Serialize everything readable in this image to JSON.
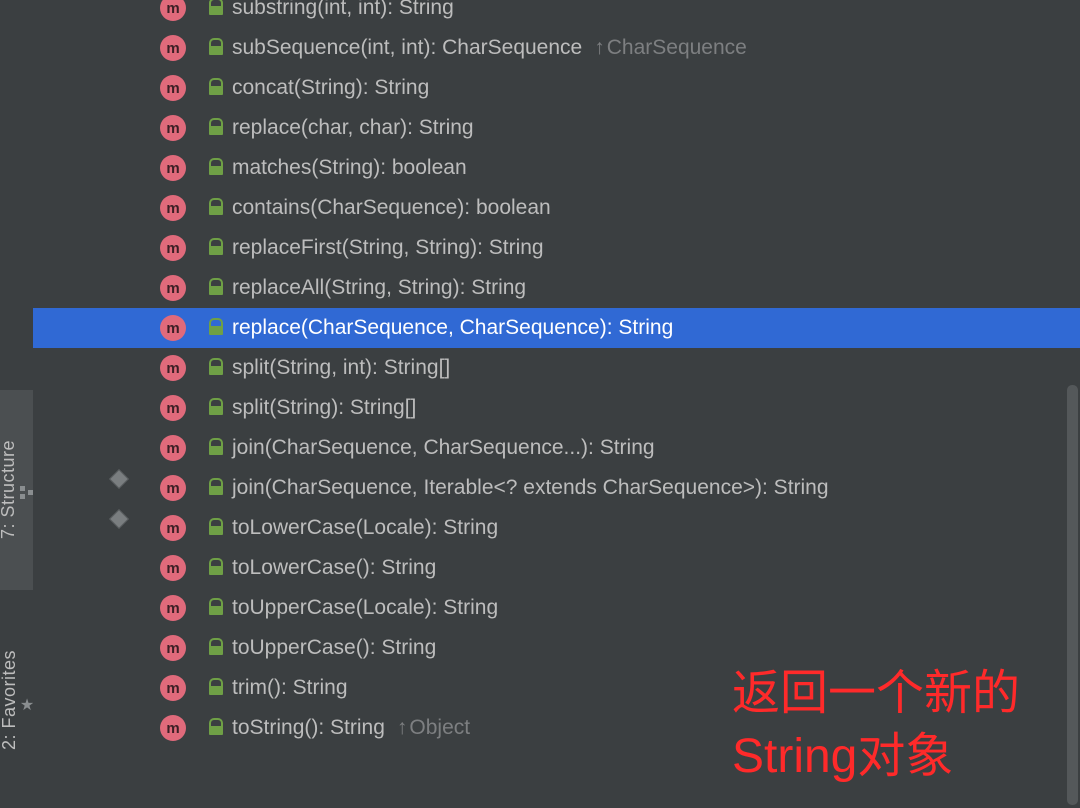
{
  "toolwindows": [
    {
      "id": "structure",
      "label": "7: Structure",
      "selected": true,
      "icon": "structure"
    },
    {
      "id": "favorites",
      "label": "2: Favorites",
      "selected": false,
      "icon": "star"
    }
  ],
  "methods": [
    {
      "sig": "substring(int, int): String",
      "static": false,
      "inherit": ""
    },
    {
      "sig": "subSequence(int, int): CharSequence",
      "static": false,
      "inherit": "CharSequence"
    },
    {
      "sig": "concat(String): String",
      "static": false,
      "inherit": ""
    },
    {
      "sig": "replace(char, char): String",
      "static": false,
      "inherit": ""
    },
    {
      "sig": "matches(String): boolean",
      "static": false,
      "inherit": ""
    },
    {
      "sig": "contains(CharSequence): boolean",
      "static": false,
      "inherit": ""
    },
    {
      "sig": "replaceFirst(String, String): String",
      "static": false,
      "inherit": ""
    },
    {
      "sig": "replaceAll(String, String): String",
      "static": false,
      "inherit": ""
    },
    {
      "sig": "replace(CharSequence, CharSequence): String",
      "static": false,
      "inherit": "",
      "selected": true
    },
    {
      "sig": "split(String, int): String[]",
      "static": false,
      "inherit": ""
    },
    {
      "sig": "split(String): String[]",
      "static": false,
      "inherit": ""
    },
    {
      "sig": "join(CharSequence, CharSequence...): String",
      "static": true,
      "inherit": ""
    },
    {
      "sig": "join(CharSequence, Iterable<? extends CharSequence>): String",
      "static": true,
      "inherit": ""
    },
    {
      "sig": "toLowerCase(Locale): String",
      "static": false,
      "inherit": ""
    },
    {
      "sig": "toLowerCase(): String",
      "static": false,
      "inherit": ""
    },
    {
      "sig": "toUpperCase(Locale): String",
      "static": false,
      "inherit": ""
    },
    {
      "sig": "toUpperCase(): String",
      "static": false,
      "inherit": ""
    },
    {
      "sig": "trim(): String",
      "static": false,
      "inherit": ""
    },
    {
      "sig": "toString(): String",
      "static": false,
      "inherit": "Object"
    }
  ],
  "annotation": {
    "line1": "返回一个新的",
    "line2": "String对象"
  }
}
